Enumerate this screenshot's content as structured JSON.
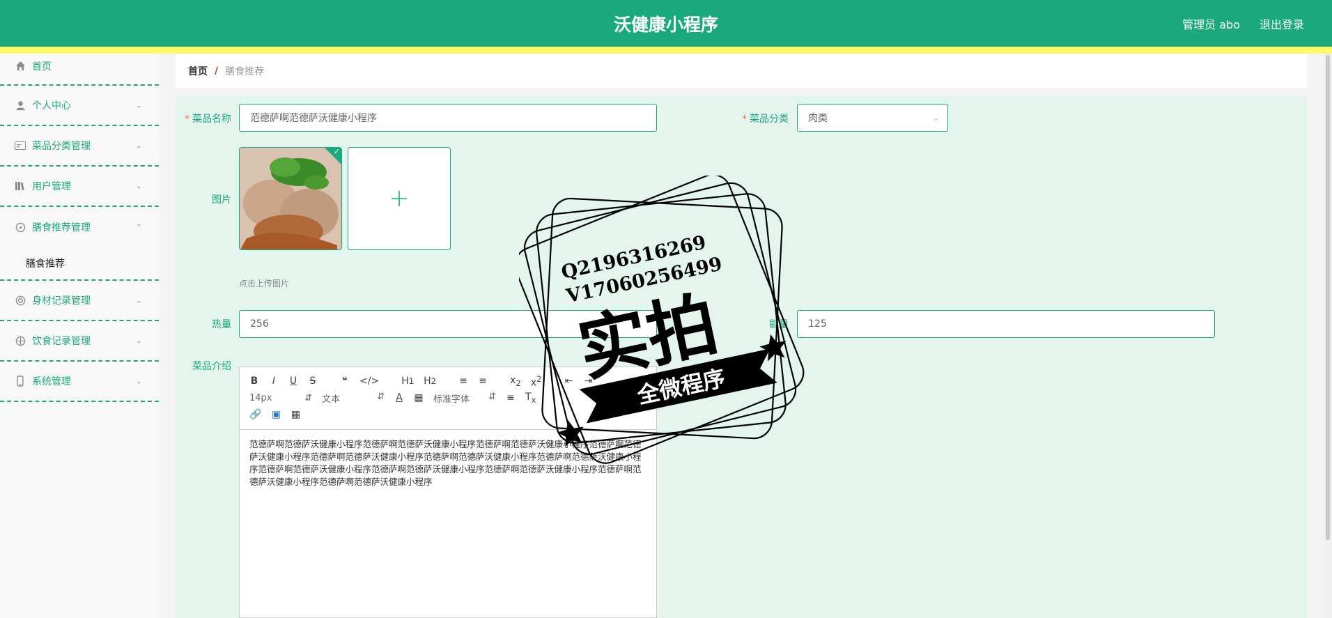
{
  "header": {
    "title": "沃健康小程序",
    "admin": "管理员 abo",
    "logout": "退出登录"
  },
  "sidebar": {
    "items": [
      {
        "label": "首页",
        "icon": "home-icon"
      },
      {
        "label": "个人中心",
        "icon": "user-icon"
      },
      {
        "label": "菜品分类管理",
        "icon": "card-icon"
      },
      {
        "label": "用户管理",
        "icon": "books-icon"
      },
      {
        "label": "膳食推荐管理",
        "icon": "compass-icon"
      },
      {
        "label": "膳食推荐",
        "icon": ""
      },
      {
        "label": "身材记录管理",
        "icon": "lifebuoy-icon"
      },
      {
        "label": "饮食记录管理",
        "icon": "basketball-icon"
      },
      {
        "label": "系统管理",
        "icon": "phone-icon"
      }
    ]
  },
  "breadcrumb": {
    "home": "首页",
    "sep": "/",
    "current": "膳食推荐"
  },
  "form": {
    "name_label": "菜品名称",
    "name_value": "范德萨啊范德萨沃健康小程序",
    "category_label": "菜品分类",
    "category_value": "肉类",
    "pic_label": "图片",
    "upload_tip": "点击上传图片",
    "heat_label": "热量",
    "heat_value": "256",
    "energy_label": "能量",
    "energy_value": "125",
    "intro_label": "菜品介绍",
    "required_mark": "*"
  },
  "editor": {
    "font_size": "14px",
    "text_type": "文本",
    "font_family": "标准字体",
    "content": "范德萨啊范德萨沃健康小程序范德萨啊范德萨沃健康小程序范德萨啊范德萨沃健康小程序范德萨啊范德萨沃健康小程序范德萨啊范德萨沃健康小程序范德萨啊范德萨沃健康小程序范德萨啊范德萨沃健康小程序范德萨啊范德萨沃健康小程序范德萨啊范德萨沃健康小程序范德萨啊范德萨沃健康小程序范德萨啊范德萨沃健康小程序范德萨啊范德萨沃健康小程序"
  },
  "stamp": {
    "line1": "Q2196316269",
    "line2": "V17060256499",
    "big": "实拍",
    "ribbon": "全微程序"
  },
  "colors": {
    "primary": "#19a97b",
    "strip": "#fbfb6a",
    "panel": "#e4f5ee"
  }
}
